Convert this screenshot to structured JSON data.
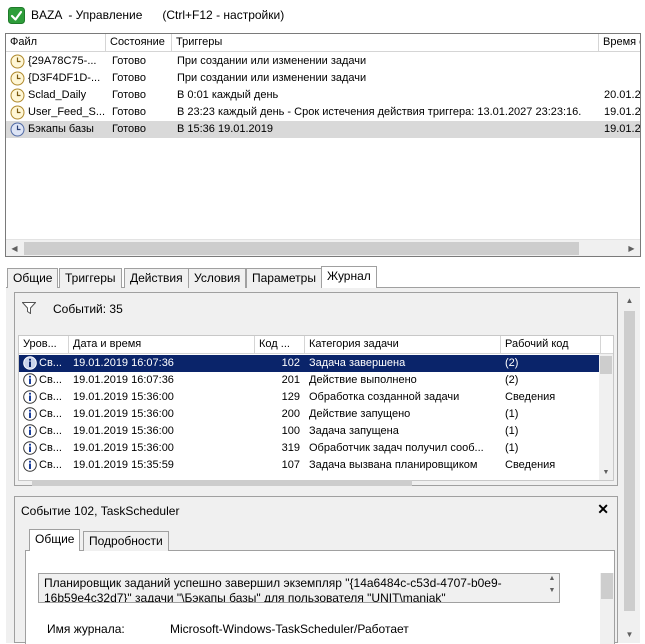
{
  "window": {
    "title": "BAZA  - Управление      (Ctrl+F12 - настройки)"
  },
  "task_list": {
    "columns": [
      "Файл",
      "Состояние",
      "Триггеры",
      "Время с"
    ],
    "rows": [
      {
        "file": "{29A78C75-...",
        "status": "Готово",
        "trigger": "При создании или изменении задачи",
        "time": ""
      },
      {
        "file": "{D3F4DF1D-...",
        "status": "Готово",
        "trigger": "При создании или изменении задачи",
        "time": ""
      },
      {
        "file": "Sclad_Daily",
        "status": "Готово",
        "trigger": "В 0:01 каждый день",
        "time": "20.01.2"
      },
      {
        "file": "User_Feed_S...",
        "status": "Готово",
        "trigger": "В 23:23 каждый день - Срок истечения действия триггера: 13.01.2027 23:23:16.",
        "time": "19.01.2"
      },
      {
        "file": "Бэкапы базы",
        "status": "Готово",
        "trigger": "В 15:36 19.01.2019",
        "time": "19.01.2"
      }
    ],
    "selected_row": 4
  },
  "tabs": [
    "Общие",
    "Триггеры",
    "Действия",
    "Условия",
    "Параметры",
    "Журнал"
  ],
  "active_tab": "Журнал",
  "journal": {
    "events_label": "Событий: 35",
    "columns": [
      "Уров...",
      "Дата и время",
      "Код ...",
      "Категория задачи",
      "Рабочий код"
    ],
    "rows": [
      {
        "level": "Св...",
        "datetime": "19.01.2019 16:07:36",
        "code": "102",
        "category": "Задача завершена",
        "opcode": "(2)"
      },
      {
        "level": "Св...",
        "datetime": "19.01.2019 16:07:36",
        "code": "201",
        "category": "Действие выполнено",
        "opcode": "(2)"
      },
      {
        "level": "Св...",
        "datetime": "19.01.2019 15:36:00",
        "code": "129",
        "category": "Обработка созданной задачи",
        "opcode": "Сведения"
      },
      {
        "level": "Св...",
        "datetime": "19.01.2019 15:36:00",
        "code": "200",
        "category": "Действие запущено",
        "opcode": "(1)"
      },
      {
        "level": "Св...",
        "datetime": "19.01.2019 15:36:00",
        "code": "100",
        "category": "Задача запущена",
        "opcode": "(1)"
      },
      {
        "level": "Св...",
        "datetime": "19.01.2019 15:36:00",
        "code": "319",
        "category": "Обработчик задач получил сооб...",
        "opcode": "(1)"
      },
      {
        "level": "Св...",
        "datetime": "19.01.2019 15:35:59",
        "code": "107",
        "category": "Задача вызвана планировщиком",
        "opcode": "Сведения"
      }
    ],
    "selected_row": 0
  },
  "detail": {
    "title": "Событие 102, TaskScheduler",
    "close_symbol": "✕",
    "tabs": [
      "Общие",
      "Подробности"
    ],
    "active_tab": "Общие",
    "message": "Планировщик заданий успешно завершил экземпляр \"{14a6484c-c53d-4707-b0e9-16b59e4c32d7}\" задачи \"\\Бэкапы базы\" для пользователя \"UNIT\\manjak\"",
    "log_name_label": "Имя журнала:",
    "log_name_value": "Microsoft-Windows-TaskScheduler/Работает"
  },
  "colors": {
    "selection_dark": "#0a246a",
    "selection_gray": "#d9d9d9",
    "panel_bg": "#f0f0f0",
    "icon_green": "#2e9d3a"
  },
  "icons": {
    "app": "app-checkmark-icon",
    "task": "clock-icon",
    "event": "info-icon",
    "filter": "filter-icon"
  }
}
